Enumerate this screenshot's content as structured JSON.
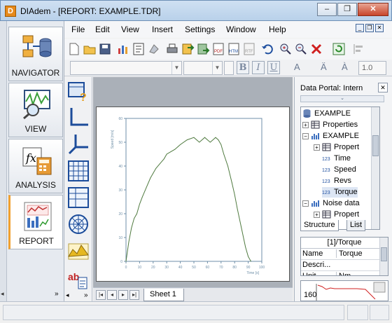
{
  "window": {
    "app_icon": "D",
    "title": "DIAdem - [REPORT:   EXAMPLE.TDR]",
    "buttons": [
      "minimize",
      "maximize",
      "close"
    ],
    "btn_labels": {
      "min": "–",
      "max": "❐",
      "close": "✕"
    }
  },
  "menu": {
    "items": [
      "File",
      "Edit",
      "View",
      "Insert",
      "Settings",
      "Window",
      "Help"
    ],
    "mdi_labels": {
      "min": "_",
      "restore": "❐",
      "close": "✕"
    }
  },
  "navigator": {
    "items": [
      {
        "label": "NAVIGATOR",
        "icon": "navigator-icon"
      },
      {
        "label": "VIEW",
        "icon": "view-icon"
      },
      {
        "label": "ANALYSIS",
        "icon": "analysis-icon"
      },
      {
        "label": "REPORT",
        "icon": "report-icon",
        "active": true
      }
    ],
    "strip_arrows": {
      "left": "◂",
      "right": "»"
    }
  },
  "format_toolbar": {
    "font_combo": "",
    "size_combo": "",
    "buttons": [
      "B",
      "I",
      "U"
    ],
    "extra_glyphs": [
      "A",
      "Ä",
      "À"
    ],
    "line_width": "1.0"
  },
  "palette": {
    "items": [
      "insert-picture-help-icon",
      "2d-axis-icon",
      "3d-axis-icon",
      "table-icon",
      "grid-table-icon",
      "polar-plot-icon",
      "3d-surface-icon",
      "text-object-icon"
    ],
    "scroll_arrows": {
      "left": "◂",
      "right": "»"
    }
  },
  "sheet": {
    "tab_label": "Sheet 1",
    "nav_buttons": [
      "|◂",
      "◂",
      "▸",
      "▸|"
    ]
  },
  "chart_data": {
    "type": "line",
    "title": "",
    "xlabel": "Time [s]",
    "ylabel": "Speed [m/s]",
    "xlim": [
      0,
      100
    ],
    "ylim": [
      0,
      60
    ],
    "xticks": [
      0,
      10,
      20,
      30,
      40,
      50,
      60,
      70,
      80,
      90,
      100
    ],
    "yticks": [
      0,
      10,
      20,
      30,
      40,
      50,
      60
    ],
    "series": [
      {
        "x": [
          0,
          2,
          4,
          6,
          8,
          10,
          12,
          15,
          18,
          20,
          22,
          25,
          28,
          30,
          33,
          36,
          40,
          45,
          50,
          52,
          54,
          56,
          58,
          60,
          62,
          64,
          66,
          68,
          70,
          72,
          75,
          78,
          80,
          82,
          85,
          88,
          90,
          92
        ],
        "y": [
          0,
          8,
          14,
          18,
          20,
          24,
          27,
          31,
          35,
          37,
          39,
          41,
          43,
          45,
          46,
          47,
          49,
          51,
          52,
          51,
          50,
          51,
          52,
          51,
          50,
          51,
          52,
          51,
          49,
          45,
          40,
          33,
          28,
          22,
          14,
          6,
          2,
          0
        ],
        "color": "#4f7a3f"
      }
    ]
  },
  "data_portal": {
    "title": "Data Portal: Intern",
    "close": "✕",
    "collapse": "⌄",
    "tree": [
      {
        "label": "EXAMPLE",
        "level": 0,
        "icon": "file-db-icon"
      },
      {
        "label": "Properties",
        "level": 0,
        "icon": "properties-icon",
        "expander": "+"
      },
      {
        "label": "EXAMPLE",
        "level": 0,
        "icon": "group-icon",
        "expander": "−"
      },
      {
        "label": "Propert",
        "level": 1,
        "icon": "properties-icon",
        "expander": "+"
      },
      {
        "label": "Time",
        "level": 1,
        "icon": "channel-icon"
      },
      {
        "label": "Speed",
        "level": 1,
        "icon": "channel-icon"
      },
      {
        "label": "Revs",
        "level": 1,
        "icon": "channel-icon"
      },
      {
        "label": "Torque",
        "level": 1,
        "icon": "channel-icon",
        "selected": true
      },
      {
        "label": "Noise data",
        "level": 0,
        "icon": "group-icon",
        "expander": "−"
      },
      {
        "label": "Propert",
        "level": 1,
        "icon": "properties-icon",
        "expander": "+"
      }
    ],
    "channel_glyph": "123",
    "tabs": [
      "Structure",
      "List"
    ],
    "props": {
      "header": "[1]/Torque",
      "rows": [
        {
          "key": "Name",
          "value": "Torque"
        },
        {
          "key": "Descri...",
          "value": ""
        },
        {
          "key": "Unit",
          "value": "Nm"
        }
      ]
    },
    "preview": {
      "value": "160"
    }
  }
}
